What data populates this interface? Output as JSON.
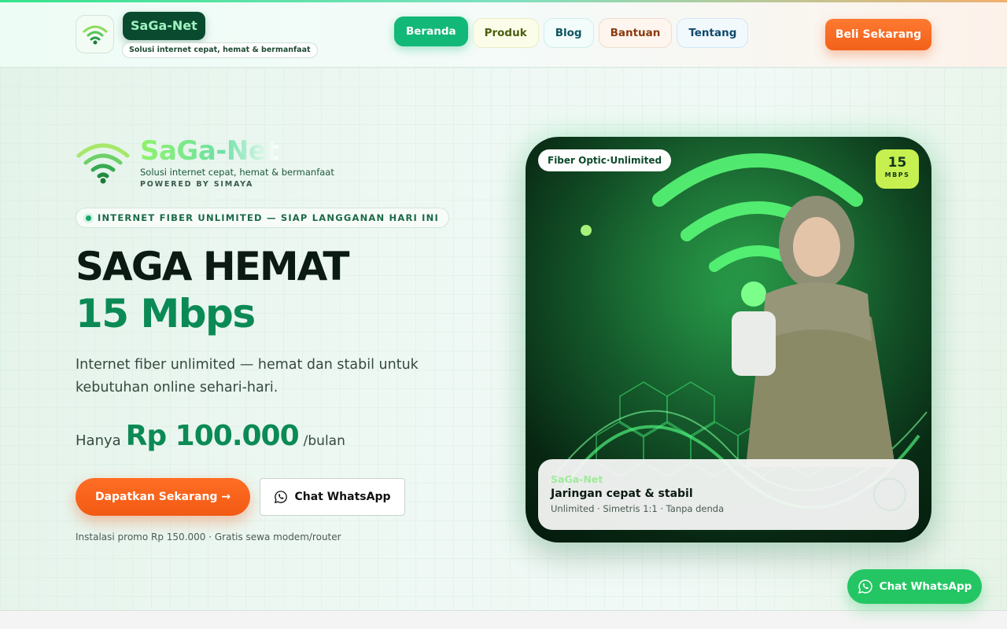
{
  "header": {
    "brand": "SaGa-Net",
    "tagline": "Solusi internet cepat, hemat & bermanfaat",
    "nav": [
      {
        "label": "Beranda",
        "active": true
      },
      {
        "label": "Produk"
      },
      {
        "label": "Blog"
      },
      {
        "label": "Bantuan"
      },
      {
        "label": "Tentang"
      }
    ],
    "buy_label": "Beli Sekarang"
  },
  "hero": {
    "brand": "SaGa-Net",
    "tagline": "Solusi internet cepat, hemat & bermanfaat",
    "powered": "POWERED BY SIMAYA",
    "announcement": "INTERNET FIBER UNLIMITED — SIAP LANGGANAN HARI INI",
    "title": "SAGA HEMAT",
    "speed_title": "15 Mbps",
    "description": "Internet fiber unlimited — hemat dan stabil untuk kebutuhan online sehari-hari.",
    "price_prefix": "Hanya",
    "price": "Rp 100.000",
    "price_suffix": "/bulan",
    "cta_label": "Dapatkan Sekarang →",
    "whatsapp_label": "Chat WhatsApp",
    "promo": "Instalasi promo Rp 150.000 · Gratis sewa modem/router"
  },
  "card": {
    "badge": "Fiber Optic·Unlimited",
    "speed_num": "15",
    "speed_unit": "MBPS",
    "info_brand": "SaGa-Net",
    "info_title": "Jaringan cepat & stabil",
    "info_sub": "Unlimited · Simetris 1:1 · Tanpa denda"
  },
  "float_whatsapp": {
    "label": "Chat WhatsApp"
  },
  "colors": {
    "primary": "#12b877",
    "accent": "#f2601a",
    "brand_dark": "#0a4a2e",
    "whatsapp": "#24c664"
  }
}
